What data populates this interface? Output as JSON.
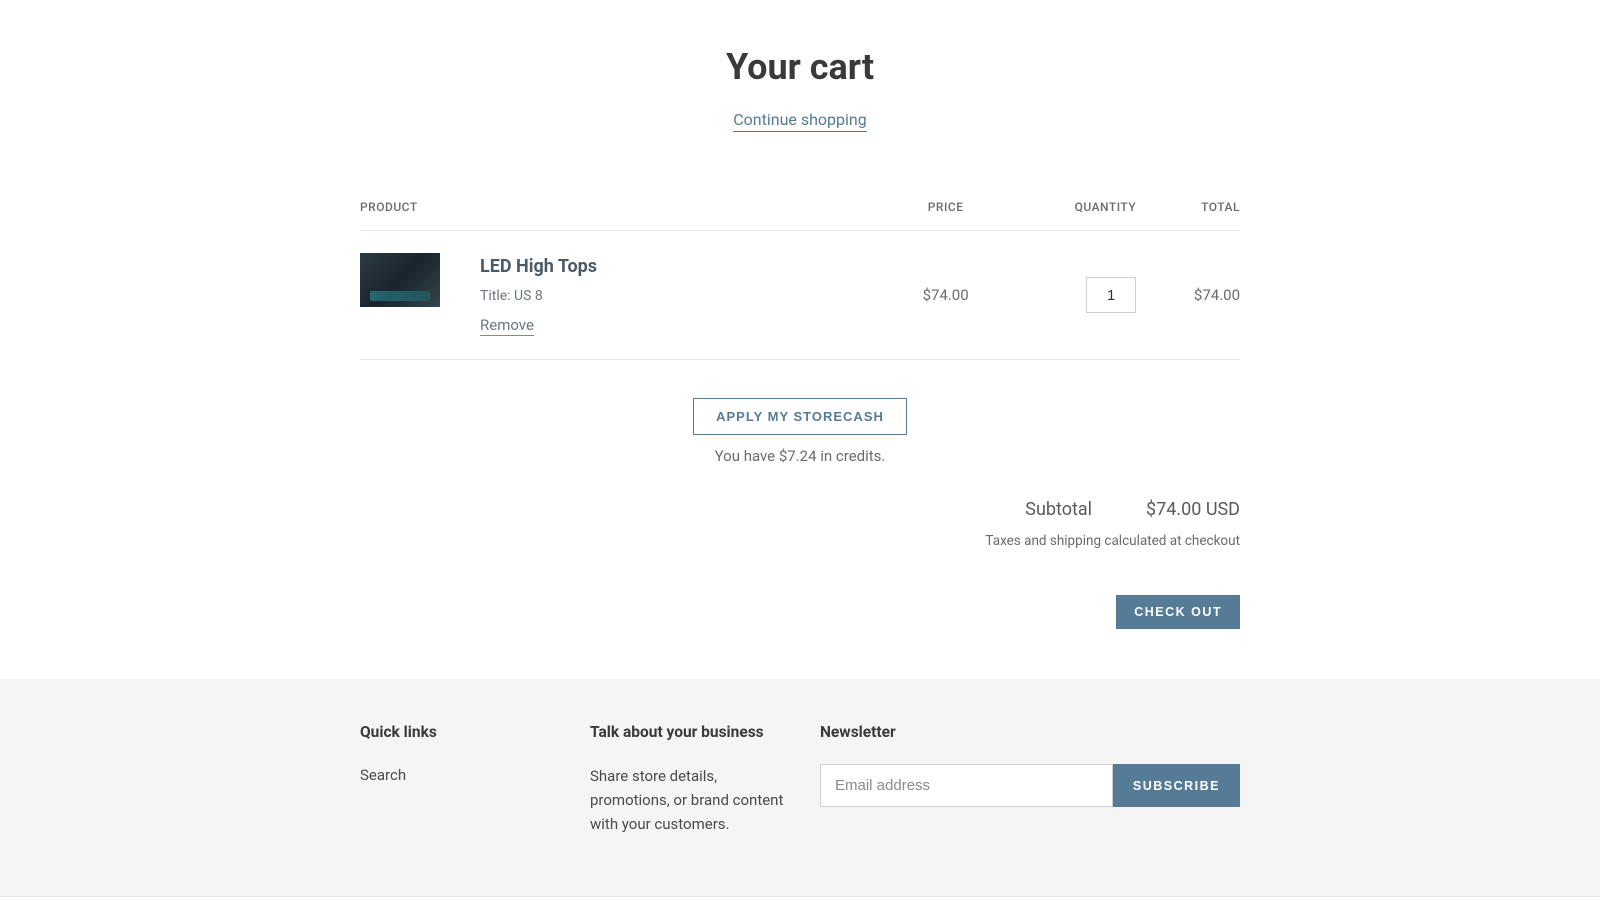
{
  "cart": {
    "title": "Your cart",
    "continue_label": "Continue shopping",
    "columns": {
      "product": "PRODUCT",
      "price": "PRICE",
      "quantity": "QUANTITY",
      "total": "TOTAL"
    },
    "item": {
      "name": "LED High Tops",
      "variant": "Title: US 8",
      "remove_label": "Remove",
      "price": "$74.00",
      "quantity": "1",
      "total": "$74.00"
    },
    "storecash": {
      "apply_label": "APPLY MY STORECASH",
      "credits_text": "You have $7.24 in credits."
    },
    "subtotal_label": "Subtotal",
    "subtotal_value": "$74.00 USD",
    "tax_note": "Taxes and shipping calculated at checkout",
    "checkout_label": "CHECK OUT"
  },
  "footer": {
    "quick_links": {
      "heading": "Quick links",
      "search": "Search"
    },
    "about": {
      "heading": "Talk about your business",
      "body": "Share store details, promotions, or brand content with your customers."
    },
    "newsletter": {
      "heading": "Newsletter",
      "placeholder": "Email address",
      "subscribe_label": "SUBSCRIBE"
    }
  }
}
